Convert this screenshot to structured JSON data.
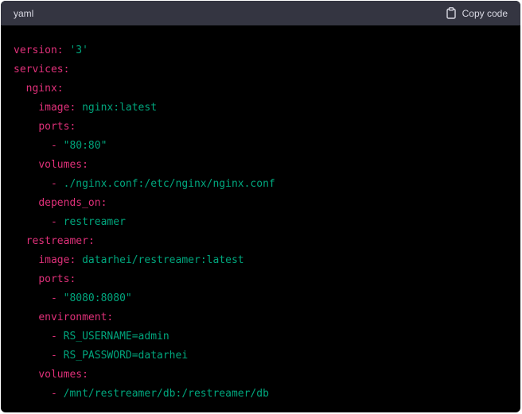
{
  "header": {
    "language": "yaml",
    "copy_label": "Copy code",
    "copy_icon": "clipboard-icon"
  },
  "colors": {
    "key": "#df3079",
    "string": "#00a67d",
    "header_bg": "#343541",
    "code_bg": "#000000"
  },
  "code": {
    "lines": [
      {
        "indent": "",
        "key": "version",
        "sep": ": ",
        "value": "'3'"
      },
      {
        "indent": "",
        "key": "services",
        "sep": ":",
        "value": ""
      },
      {
        "indent": "  ",
        "key": "nginx",
        "sep": ":",
        "value": ""
      },
      {
        "indent": "    ",
        "key": "image",
        "sep": ": ",
        "value": "nginx:latest"
      },
      {
        "indent": "    ",
        "key": "ports",
        "sep": ":",
        "value": ""
      },
      {
        "indent": "      ",
        "key": "",
        "sep": "- ",
        "value": "\"80:80\""
      },
      {
        "indent": "    ",
        "key": "volumes",
        "sep": ":",
        "value": ""
      },
      {
        "indent": "      ",
        "key": "",
        "sep": "- ",
        "value": "./nginx.conf:/etc/nginx/nginx.conf"
      },
      {
        "indent": "    ",
        "key": "depends_on",
        "sep": ":",
        "value": ""
      },
      {
        "indent": "      ",
        "key": "",
        "sep": "- ",
        "value": "restreamer"
      },
      {
        "indent": "  ",
        "key": "restreamer",
        "sep": ":",
        "value": ""
      },
      {
        "indent": "    ",
        "key": "image",
        "sep": ": ",
        "value": "datarhei/restreamer:latest"
      },
      {
        "indent": "    ",
        "key": "ports",
        "sep": ":",
        "value": ""
      },
      {
        "indent": "      ",
        "key": "",
        "sep": "- ",
        "value": "\"8080:8080\""
      },
      {
        "indent": "    ",
        "key": "environment",
        "sep": ":",
        "value": ""
      },
      {
        "indent": "      ",
        "key": "",
        "sep": "- ",
        "value": "RS_USERNAME=admin"
      },
      {
        "indent": "      ",
        "key": "",
        "sep": "- ",
        "value": "RS_PASSWORD=datarhei"
      },
      {
        "indent": "    ",
        "key": "volumes",
        "sep": ":",
        "value": ""
      },
      {
        "indent": "      ",
        "key": "",
        "sep": "- ",
        "value": "/mnt/restreamer/db:/restreamer/db"
      }
    ]
  }
}
